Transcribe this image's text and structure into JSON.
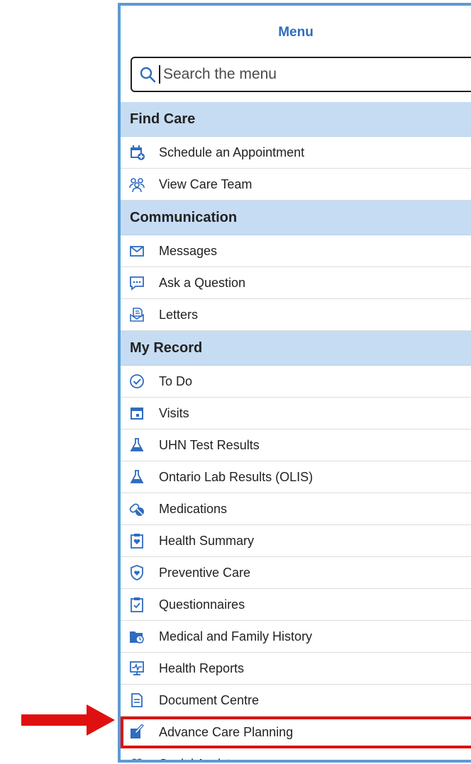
{
  "menu": {
    "title": "Menu",
    "search_placeholder": "Search the menu"
  },
  "sections": [
    {
      "heading": "Find Care",
      "items": [
        {
          "label": "Schedule an Appointment",
          "icon": "calendar-plus-icon"
        },
        {
          "label": "View Care Team",
          "icon": "care-team-icon"
        }
      ]
    },
    {
      "heading": "Communication",
      "items": [
        {
          "label": "Messages",
          "icon": "envelope-icon"
        },
        {
          "label": "Ask a Question",
          "icon": "chat-bubble-icon"
        },
        {
          "label": "Letters",
          "icon": "letter-icon"
        }
      ]
    },
    {
      "heading": "My Record",
      "items": [
        {
          "label": "To Do",
          "icon": "checkmark-clock-icon"
        },
        {
          "label": "Visits",
          "icon": "calendar-icon"
        },
        {
          "label": "UHN Test Results",
          "icon": "flask-icon"
        },
        {
          "label": "Ontario Lab Results (OLIS)",
          "icon": "flask-icon"
        },
        {
          "label": "Medications",
          "icon": "pills-icon"
        },
        {
          "label": "Health Summary",
          "icon": "clipboard-heart-icon"
        },
        {
          "label": "Preventive Care",
          "icon": "shield-heart-icon"
        },
        {
          "label": "Questionnaires",
          "icon": "clipboard-check-icon"
        },
        {
          "label": "Medical and Family History",
          "icon": "folder-clock-icon"
        },
        {
          "label": "Health Reports",
          "icon": "health-report-icon"
        },
        {
          "label": "Document Centre",
          "icon": "document-icon"
        },
        {
          "label": "Advance Care Planning",
          "icon": "pen-paper-icon",
          "highlighted": true
        },
        {
          "label": "Social Assistance",
          "icon": "heart-hands-icon"
        }
      ]
    }
  ],
  "colors": {
    "accent": "#2f6cc0",
    "panel_border": "#5b9bd5",
    "section_bg": "#c6dcf3",
    "highlight": "#e01010"
  }
}
